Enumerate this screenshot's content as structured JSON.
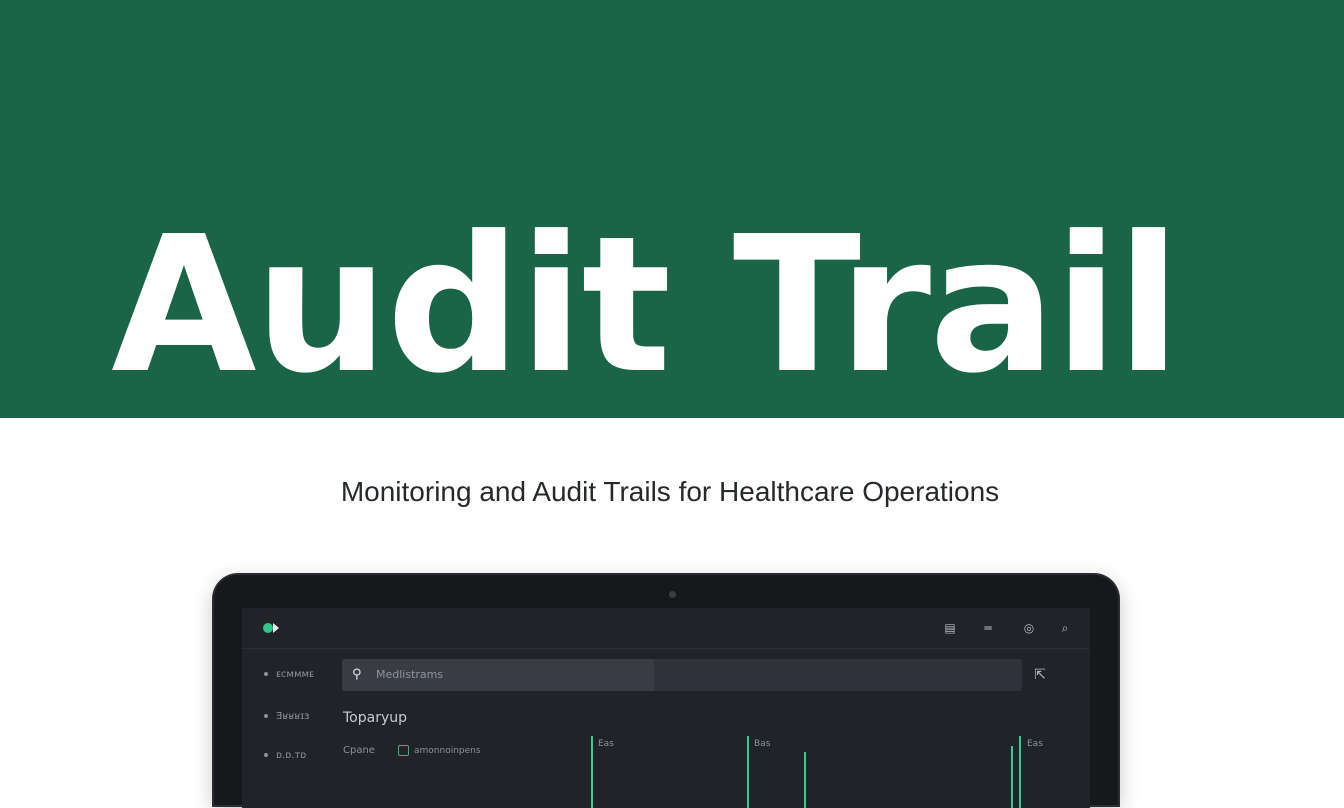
{
  "hero": {
    "title": "Audit Trail",
    "background": "#1a6448"
  },
  "subtitle": "Monitoring and Audit Trails for Healthcare Operations",
  "app": {
    "top_icons": [
      "calendar-icon",
      "menu-icon",
      "help-icon",
      "search-icon"
    ],
    "sidebar": [
      {
        "label": "ᴇᴄᴍᴍᴍᴇ"
      },
      {
        "label": "Ǝʁʁʁɪɜ"
      },
      {
        "label": "ᴅ.ᴅ.ᴛᴅ"
      }
    ],
    "search": {
      "value": "Medlistrams"
    },
    "section_title": "Toparyup",
    "row": {
      "label": "Cpane",
      "badge": "amonnoinpens"
    },
    "chart_labels": [
      "Eas",
      "Bas",
      "Eas"
    ],
    "accent": "#2fd08f"
  }
}
